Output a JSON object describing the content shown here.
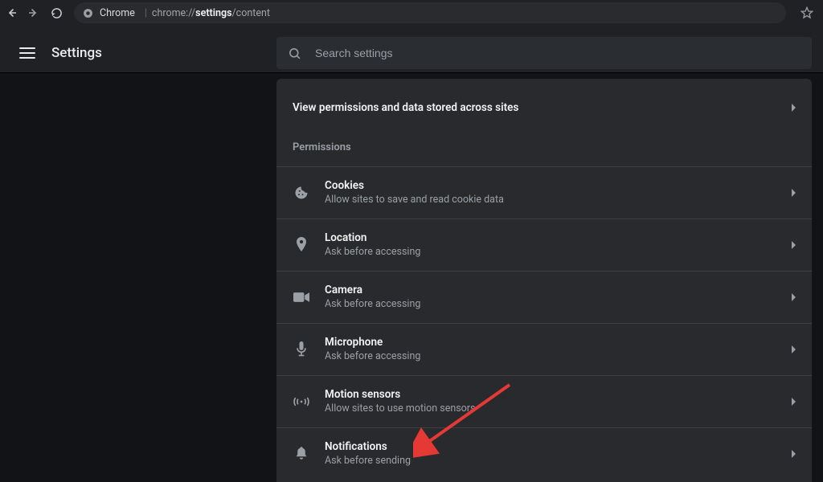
{
  "browser": {
    "app_label": "Chrome",
    "url_pre": "chrome://",
    "url_strong": "settings",
    "url_post": "/content"
  },
  "header": {
    "title": "Settings",
    "search_placeholder": "Search settings"
  },
  "content": {
    "view_permissions_link": "View permissions and data stored across sites",
    "permissions_label": "Permissions",
    "items": [
      {
        "title": "Cookies",
        "sub": "Allow sites to save and read cookie data"
      },
      {
        "title": "Location",
        "sub": "Ask before accessing"
      },
      {
        "title": "Camera",
        "sub": "Ask before accessing"
      },
      {
        "title": "Microphone",
        "sub": "Ask before accessing"
      },
      {
        "title": "Motion sensors",
        "sub": "Allow sites to use motion sensors"
      },
      {
        "title": "Notifications",
        "sub": "Ask before sending"
      }
    ]
  }
}
